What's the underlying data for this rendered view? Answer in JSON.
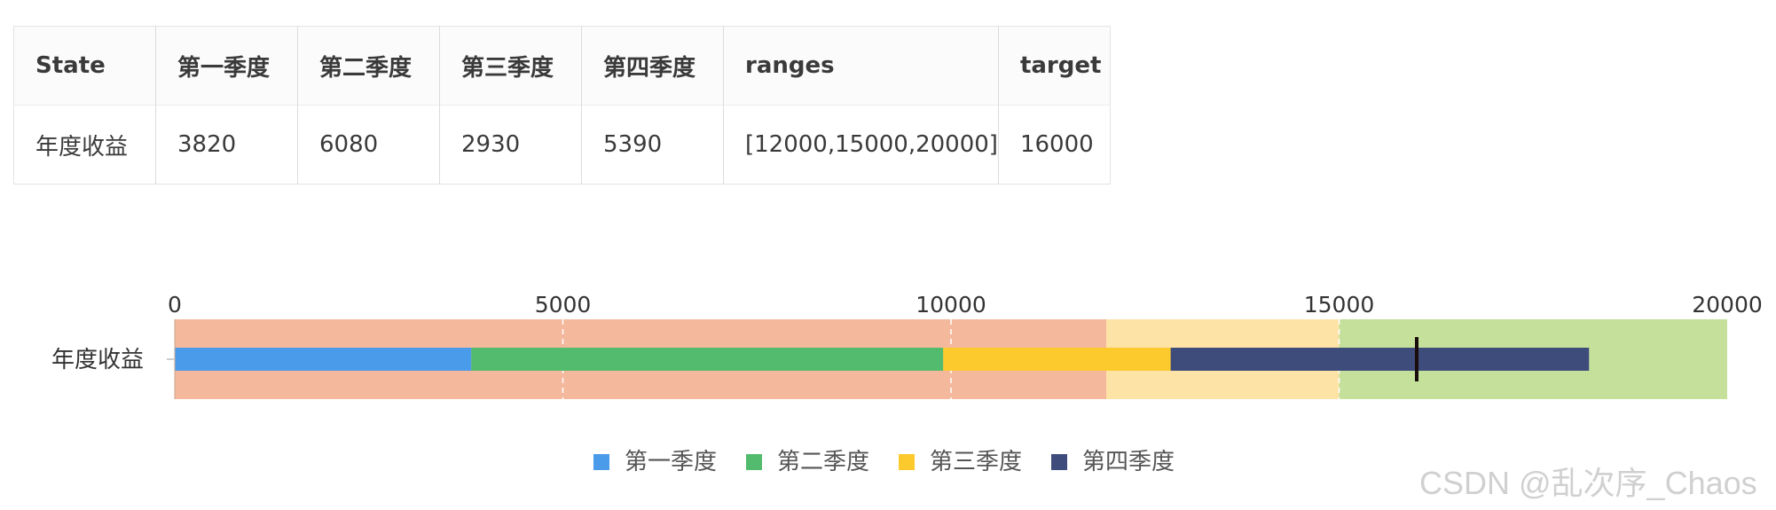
{
  "table": {
    "headers": [
      "State",
      "第一季度",
      "第二季度",
      "第三季度",
      "第四季度",
      "ranges",
      "target"
    ],
    "rows": [
      [
        "年度收益",
        "3820",
        "6080",
        "2930",
        "5390",
        "[12000,15000,20000]",
        "16000"
      ]
    ]
  },
  "chart_data": {
    "type": "bar",
    "orientation": "horizontal",
    "stacked": true,
    "categories": [
      "年度收益"
    ],
    "series": [
      {
        "name": "第一季度",
        "values": [
          3820
        ],
        "color": "#4a9bea"
      },
      {
        "name": "第二季度",
        "values": [
          6080
        ],
        "color": "#52bb6e"
      },
      {
        "name": "第三季度",
        "values": [
          2930
        ],
        "color": "#fcca2c"
      },
      {
        "name": "第四季度",
        "values": [
          5390
        ],
        "color": "#3d4c7b"
      }
    ],
    "ranges": [
      {
        "to": 12000,
        "color": "#f4b89c"
      },
      {
        "to": 15000,
        "color": "#fde3a6"
      },
      {
        "to": 20000,
        "color": "#c5e09a"
      }
    ],
    "target": 16000,
    "target_color": "#1a0c0c",
    "xlim": [
      0,
      20000
    ],
    "xticks": [
      "0",
      "5000",
      "10000",
      "15000",
      "20000"
    ],
    "grid": "dashed white vertical lines",
    "legend_position": "bottom-center",
    "title": "",
    "xlabel": "",
    "ylabel": ""
  },
  "watermark": "CSDN @乱次序_Chaos"
}
